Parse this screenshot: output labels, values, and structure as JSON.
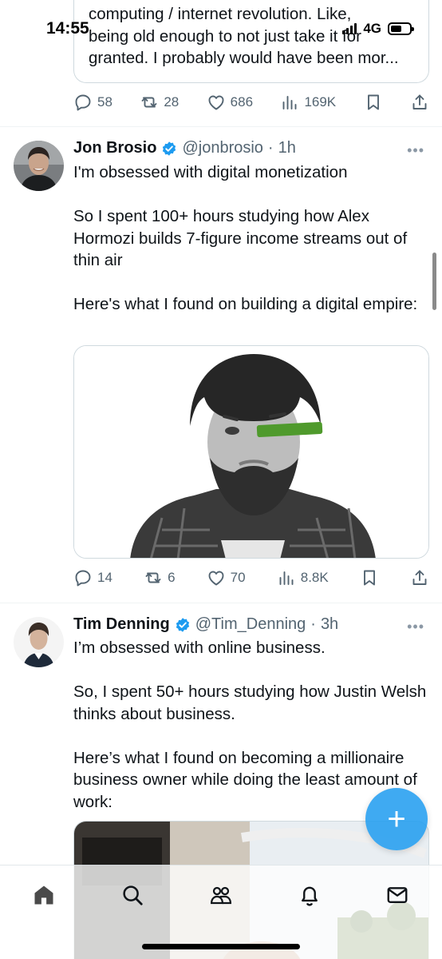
{
  "status_bar": {
    "time": "14:55",
    "network": "4G"
  },
  "previous_post": {
    "quote_text": "computing / internet revolution. Like,\nbeing old enough to not just take it for\ngranted. I probably would have been mor...",
    "replies": "58",
    "reposts": "28",
    "likes": "686",
    "views": "169K"
  },
  "posts": [
    {
      "author": "Jon Brosio",
      "handle": "@jonbrosio",
      "time": "1h",
      "paragraphs": [
        "I'm obsessed with digital monetization",
        "So I spent 100+ hours studying how Alex Hormozi builds 7-figure income streams out of thin air",
        "Here's what I found on building a digital empire:"
      ],
      "replies": "14",
      "reposts": "6",
      "likes": "70",
      "views": "8.8K"
    },
    {
      "author": "Tim Denning",
      "handle": "@Tim_Denning",
      "time": "3h",
      "paragraphs": [
        "I’m obsessed with online business.",
        "So, I spent 50+ hours studying how Justin Welsh thinks about business.",
        "Here’s what I found on becoming a millionaire business owner while doing the least amount of work:"
      ]
    }
  ],
  "ui": {
    "separator_dot": "·",
    "more_label": "•••",
    "compose_label": "+"
  },
  "icons": {
    "post_actions": [
      "reply-icon",
      "repost-icon",
      "like-icon",
      "views-icon",
      "bookmark-icon",
      "share-icon"
    ],
    "tabs": [
      "home-icon",
      "search-icon",
      "communities-icon",
      "notifications-icon",
      "messages-icon"
    ]
  },
  "colors": {
    "accent": "#1d9bf0",
    "text": "#0f1419",
    "secondary": "#536471",
    "border": "#cfd9de"
  }
}
